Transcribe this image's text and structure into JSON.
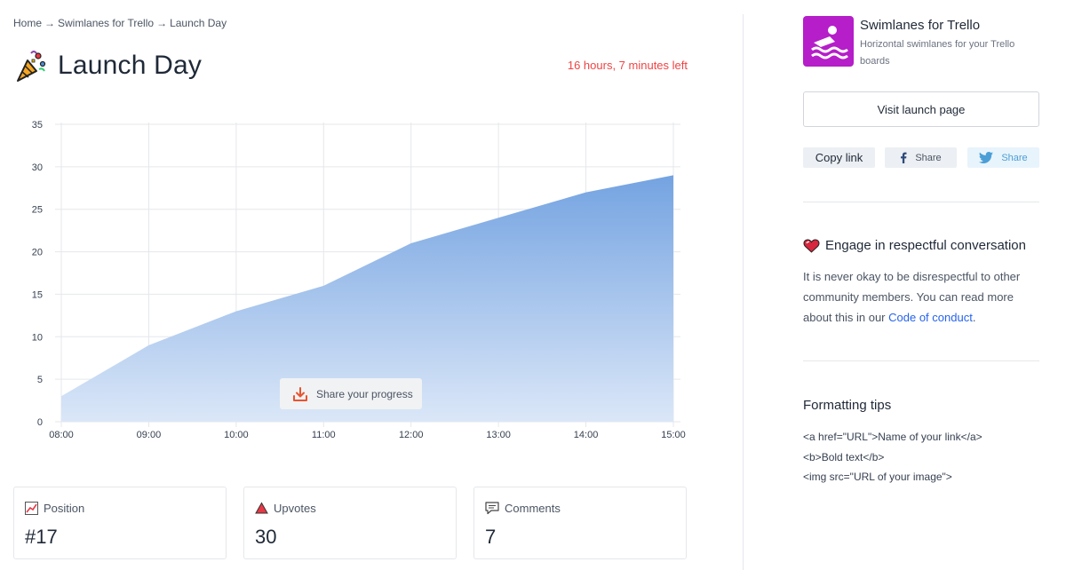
{
  "breadcrumb": {
    "home": "Home",
    "sep": "→",
    "product": "Swimlanes for Trello",
    "current": "Launch Day"
  },
  "page": {
    "title": "Launch Day",
    "time_left": "16 hours, 7 minutes left"
  },
  "share_progress": {
    "label": "Share your progress"
  },
  "stats": [
    {
      "label": "Position",
      "value": "#17",
      "icon": "trending-chart-icon"
    },
    {
      "label": "Upvotes",
      "value": "30",
      "icon": "upvote-triangle-icon"
    },
    {
      "label": "Comments",
      "value": "7",
      "icon": "comment-bubble-icon"
    }
  ],
  "app": {
    "name": "Swimlanes for Trello",
    "tagline": "Horizontal swimlanes for your Trello boards",
    "icon": "swimmer-icon",
    "icon_color": "#b51ec9"
  },
  "actions": {
    "visit": "Visit launch page",
    "copy": "Copy link",
    "facebook": "Share",
    "twitter": "Share"
  },
  "engage": {
    "title": "Engage in respectful conversation",
    "text": "It is never okay to be disrespectful to other community members. You can read more about this in our ",
    "link": "Code of conduct",
    "end": "."
  },
  "tips": {
    "title": "Formatting tips",
    "lines": [
      "<a href=\"URL\">Name of your link</a>",
      "<b>Bold text</b>",
      "<img src=\"URL of your image\">"
    ]
  },
  "chart_data": {
    "type": "area",
    "x": [
      "08:00",
      "09:00",
      "10:00",
      "11:00",
      "12:00",
      "13:00",
      "14:00",
      "15:00"
    ],
    "values": [
      3,
      9,
      13,
      16,
      21,
      24,
      27,
      29
    ],
    "ylim": [
      0,
      35
    ],
    "yticks": [
      0,
      5,
      10,
      15,
      20,
      25,
      30,
      35
    ],
    "grid": true,
    "colors": {
      "fill_top": "#74a3e1",
      "fill_bottom": "#dbe7f8",
      "grid": "#e5e7eb"
    }
  },
  "colors": {
    "accent_red": "#ef4444",
    "link_blue": "#2563eb",
    "twitter": "#4b9fd6"
  }
}
